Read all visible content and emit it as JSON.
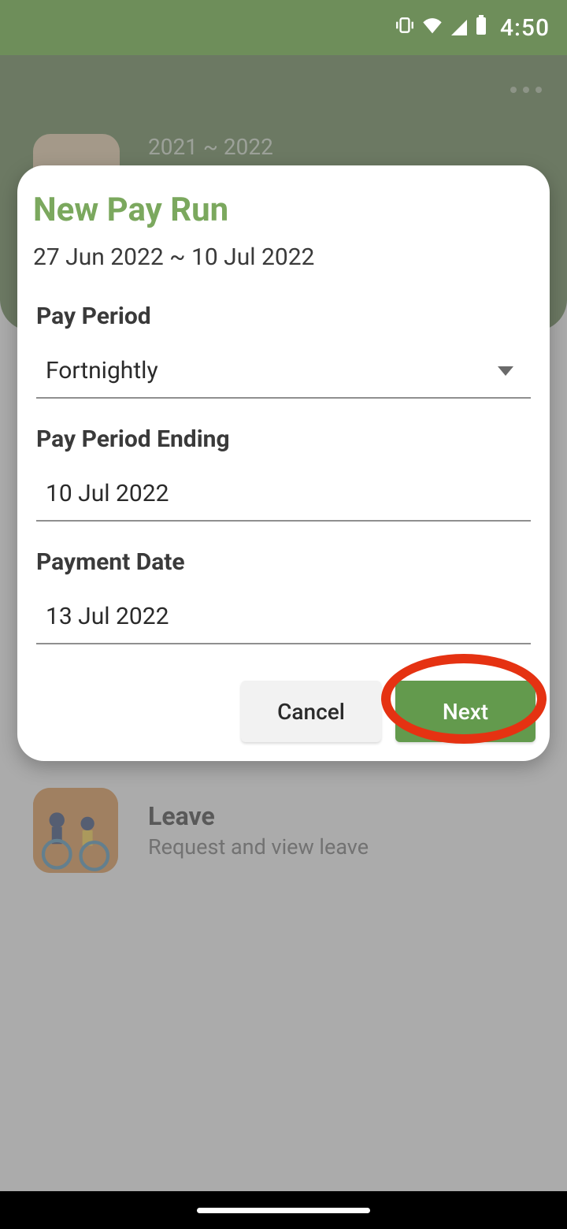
{
  "status": {
    "time": "4:50"
  },
  "header": {
    "year_range": "2021 ~ 2022"
  },
  "bg_list": {
    "leave": {
      "title": "Leave",
      "subtitle": "Request and view leave"
    }
  },
  "modal": {
    "title": "New Pay Run",
    "subtitle": "27 Jun 2022 ~ 10 Jul 2022",
    "fields": {
      "pay_period": {
        "label": "Pay Period",
        "value": "Fortnightly"
      },
      "pay_period_ending": {
        "label": "Pay Period Ending",
        "value": "10 Jul 2022"
      },
      "payment_date": {
        "label": "Payment Date",
        "value": "13 Jul 2022"
      }
    },
    "actions": {
      "cancel": "Cancel",
      "next": "Next"
    }
  }
}
